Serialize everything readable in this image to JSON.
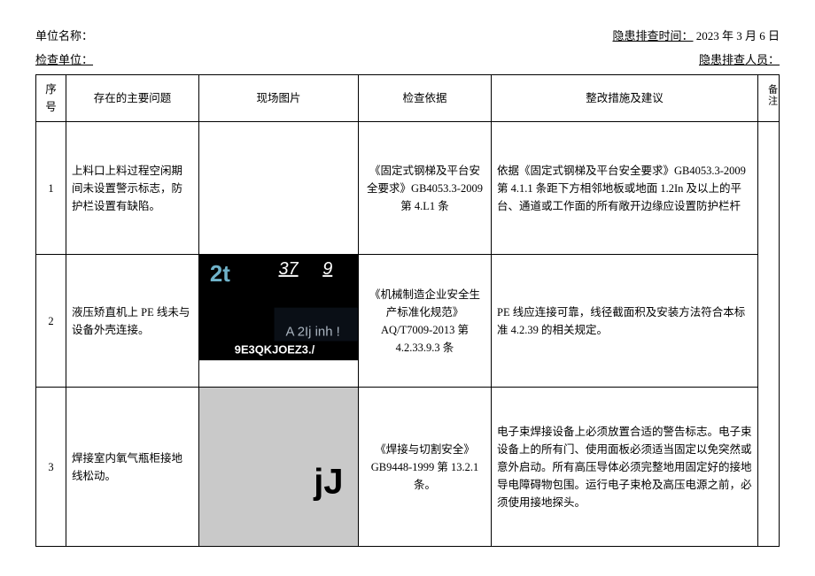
{
  "header": {
    "unit_name_label": "单位名称：",
    "inspect_time_label": "隐患排查时间：",
    "inspect_time_value": "2023 年 3 月 6 日",
    "check_unit_label": "检查单位：",
    "inspector_label": "隐患排查人员："
  },
  "columns": {
    "seq": "序号",
    "issue": "存在的主要问题",
    "photo": "现场图片",
    "basis": "检查依据",
    "action": "整改措施及建议",
    "note": "备注"
  },
  "rows": [
    {
      "seq": "1",
      "issue": "上料口上料过程空闲期间未设置警示标志，防护栏设置有缺陷。",
      "basis": "《固定式钢梯及平台安全要求》GB4053.3-2009 第 4.L1 条",
      "action": "依据《固定式钢梯及平台安全要求》GB4053.3-2009 第 4.1.1 条距下方相邻地板或地面 1.2In 及以上的平台、通道或工作面的所有敞开边缘应设置防护栏杆"
    },
    {
      "seq": "2",
      "issue": "液压矫直机上 PE 线未与设备外壳连接。",
      "basis": "《机械制造企业安全生产标准化规范》AQ/T7009-2013 第 4.2.33.9.3 条",
      "action": "PE 线应连接可靠，线径截面积及安装方法符合本标准 4.2.39 的相关规定。"
    },
    {
      "seq": "3",
      "issue": "焊接室内氧气瓶柜接地线松动。",
      "basis": "《焊接与切割安全》GB9448-1999 第 13.2.1 条。",
      "action": "电子束焊接设备上必须放置合适的警告标志。电子束设备上的所有门、使用面板必须适当固定以免突然或意外启动。所有高压导体必须完整地用固定好的接地导电障碍物包围。运行电子束枪及高压电源之前，必须使用接地探头。"
    }
  ],
  "photo2": {
    "t2t": "2t",
    "n37": "37",
    "n9": "9",
    "code": "9E3QKJOEZ3./",
    "frag": "A 2Ij inh !"
  },
  "photo3": {
    "jj": "jJ"
  }
}
